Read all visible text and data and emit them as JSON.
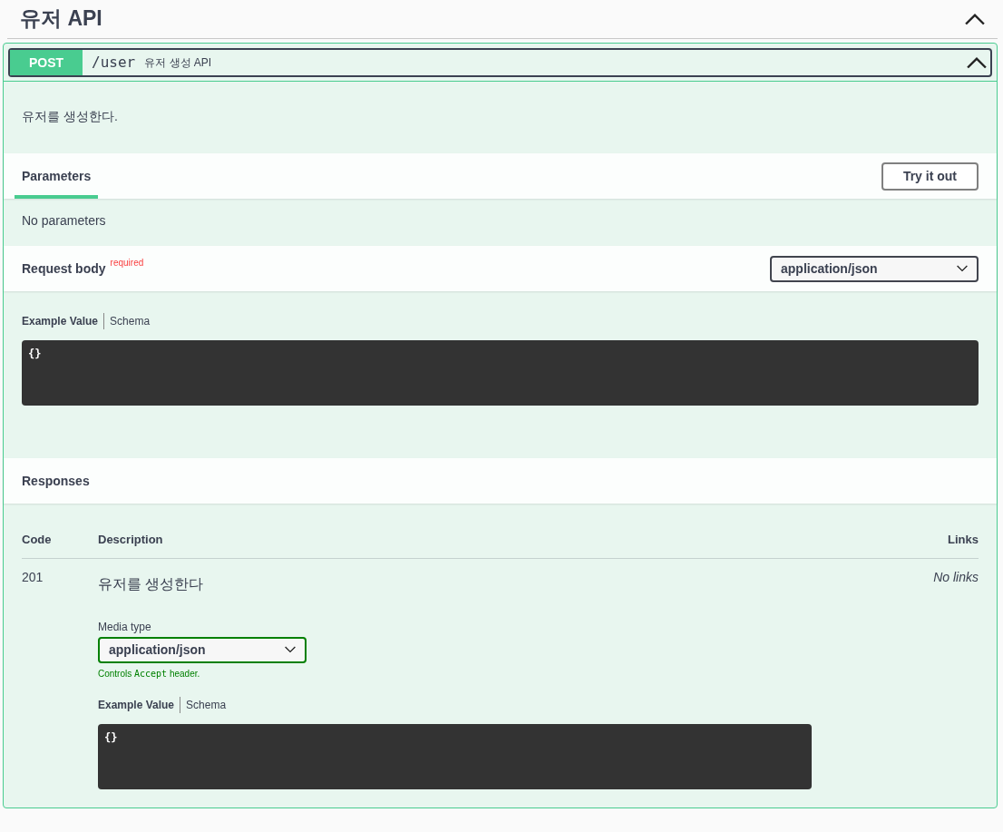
{
  "section": {
    "title": "유저 API",
    "expanded": true
  },
  "operation": {
    "method": "POST",
    "path": "/user",
    "summary": "유저 생성 API",
    "expanded": true,
    "description": "유저를 생성한다."
  },
  "parameters": {
    "tabs": [
      {
        "label": "Parameters",
        "selected": true
      }
    ],
    "try_button": "Try it out",
    "empty_text": "No parameters"
  },
  "request_body": {
    "title": "Request body",
    "required_label": "required",
    "media_select": "application/json",
    "example_tabs": [
      {
        "label": "Example Value",
        "selected": true
      },
      {
        "label": "Schema",
        "selected": false
      }
    ],
    "example": "{}"
  },
  "responses": {
    "title": "Responses",
    "columns": [
      "Code",
      "Description",
      "Links"
    ],
    "rows": [
      {
        "code": "201",
        "description": "유저를 생성한다",
        "media_label": "Media type",
        "media_select": "application/json",
        "hint_parts": [
          "Controls",
          "Accept",
          "header."
        ],
        "example_tabs": [
          {
            "label": "Example Value",
            "selected": true
          },
          {
            "label": "Schema",
            "selected": false
          }
        ],
        "example": "{}",
        "links": "No links"
      }
    ]
  }
}
